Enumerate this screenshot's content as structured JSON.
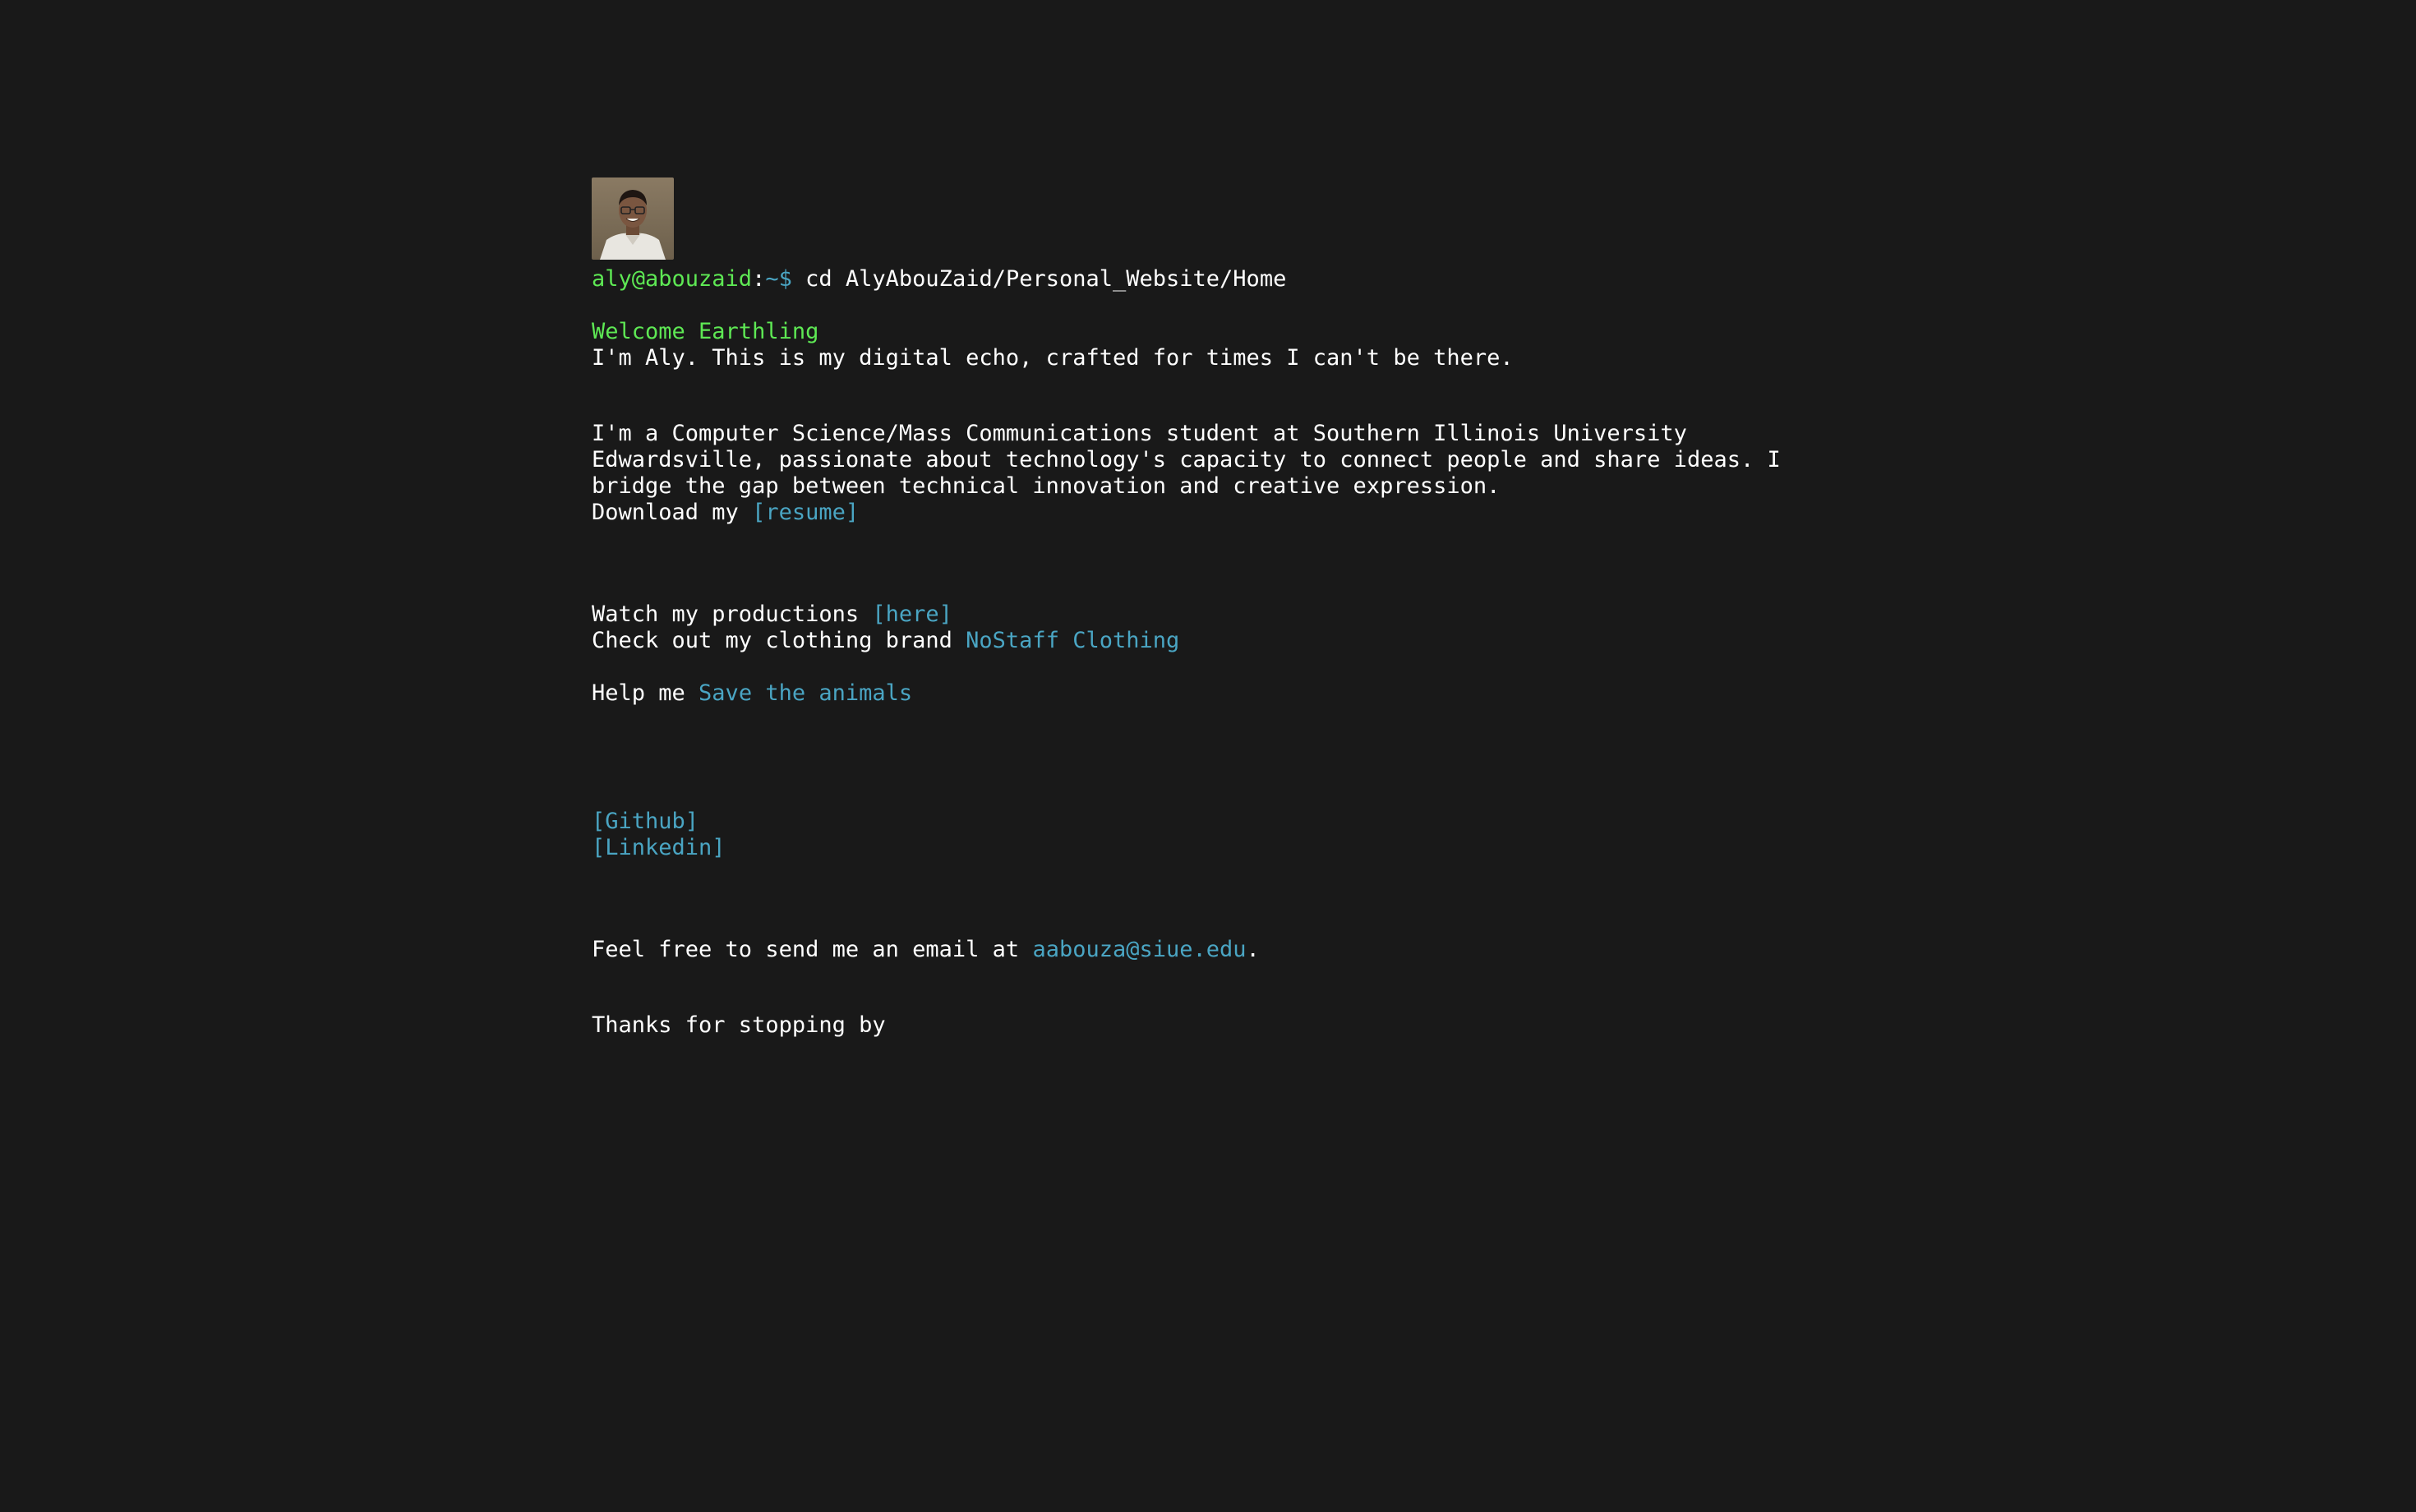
{
  "avatar": {
    "alt": "Aly AbouZaid portrait"
  },
  "prompt": {
    "user": "aly@abouzaid",
    "sep": ":",
    "path": "~",
    "dollar": "$",
    "command": " cd AlyAbouZaid/Personal_Website/Home"
  },
  "intro": {
    "welcome": "Welcome Earthling",
    "tagline": "I'm Aly. This is my digital echo, crafted for times I can't be there."
  },
  "bio": {
    "text": "I'm a Computer Science/Mass Communications student at Southern Illinois University Edwardsville, passionate about technology's capacity to connect people and share ideas. I bridge the gap between technical innovation and creative expression.",
    "download_prefix": "Download my ",
    "resume_link": "[resume]"
  },
  "links": {
    "productions_prefix": "Watch my productions ",
    "productions_link": "[here]",
    "clothing_prefix": "Check out my clothing brand ",
    "clothing_link": "NoStaff Clothing",
    "animals_prefix": "Help me ",
    "animals_link": "Save the animals"
  },
  "social": {
    "github": "[Github]",
    "linkedin": "[Linkedin]"
  },
  "contact": {
    "prefix": "Feel free to send me an email at ",
    "email": "aabouza@siue.edu",
    "suffix": "."
  },
  "outro": {
    "thanks": "Thanks for stopping by"
  },
  "colors": {
    "background": "#191919",
    "text": "#ffffff",
    "prompt_green": "#5ee854",
    "link_blue": "#4aa5c3"
  }
}
